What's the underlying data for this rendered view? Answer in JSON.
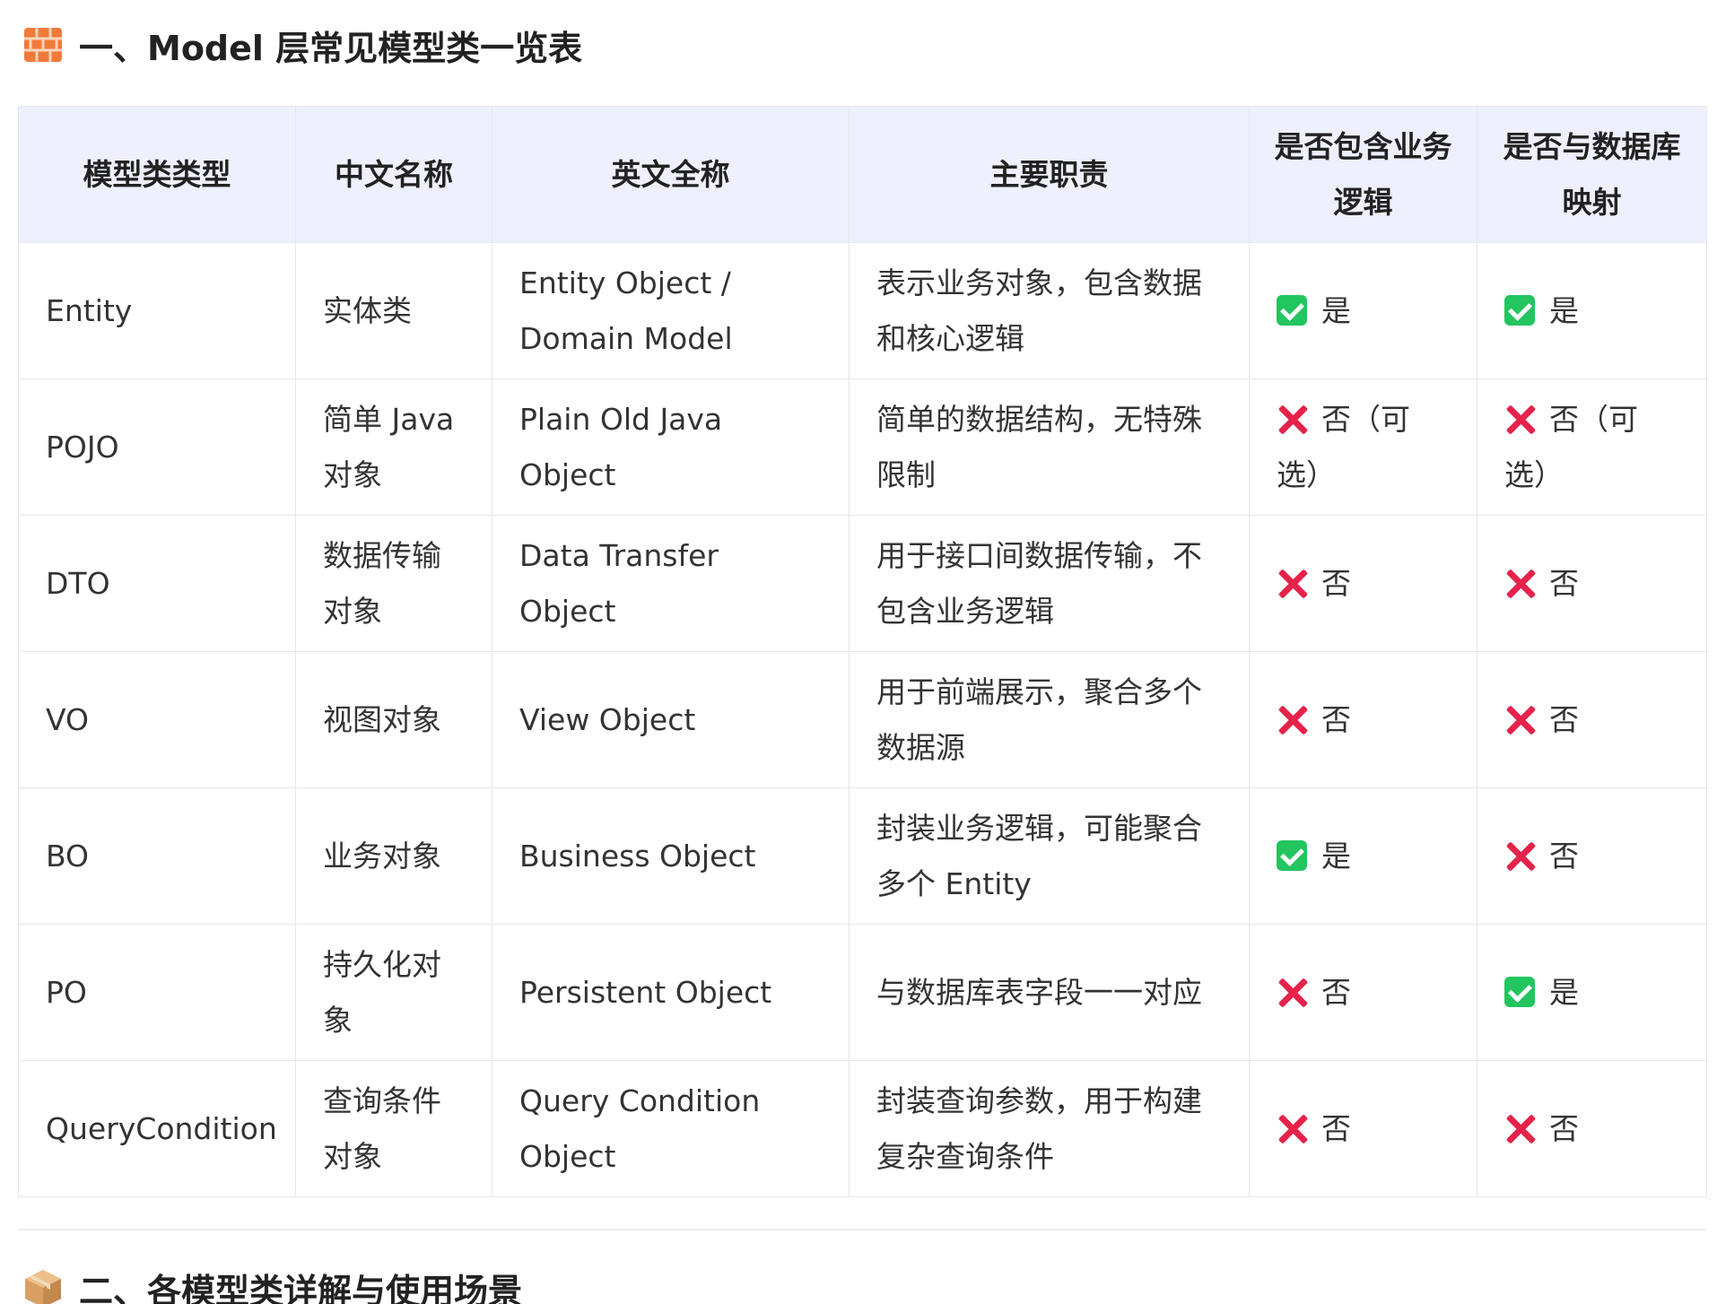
{
  "heading1": {
    "icon": "brick-icon",
    "text": "一、Model 层常见模型类一览表"
  },
  "heading2": {
    "icon": "package-icon",
    "text": "二、各模型类详解与使用场景"
  },
  "table": {
    "headers": [
      "模型类类型",
      "中文名称",
      "英文全称",
      "主要职责",
      "是否包含业务逻辑",
      "是否与数据库映射"
    ],
    "rows": [
      {
        "type": "Entity",
        "cn": "实体类",
        "en": "Entity Object / Domain Model",
        "duty": "表示业务对象，包含数据和核心逻辑",
        "logic_icon": "check",
        "logic": "是",
        "db_icon": "check",
        "db": "是"
      },
      {
        "type": "POJO",
        "cn": "简单 Java 对象",
        "en": "Plain Old Java Object",
        "duty": "简单的数据结构，无特殊限制",
        "logic_icon": "cross",
        "logic": "否（可选）",
        "db_icon": "cross",
        "db": "否（可选）"
      },
      {
        "type": "DTO",
        "cn": "数据传输对象",
        "en": "Data Transfer Object",
        "duty": "用于接口间数据传输，不包含业务逻辑",
        "logic_icon": "cross",
        "logic": "否",
        "db_icon": "cross",
        "db": "否"
      },
      {
        "type": "VO",
        "cn": "视图对象",
        "en": "View Object",
        "duty": "用于前端展示，聚合多个数据源",
        "logic_icon": "cross",
        "logic": "否",
        "db_icon": "cross",
        "db": "否"
      },
      {
        "type": "BO",
        "cn": "业务对象",
        "en": "Business Object",
        "duty": "封装业务逻辑，可能聚合多个 Entity",
        "logic_icon": "check",
        "logic": "是",
        "db_icon": "cross",
        "db": "否"
      },
      {
        "type": "PO",
        "cn": "持久化对象",
        "en": "Persistent Object",
        "duty": "与数据库表字段一一对应",
        "logic_icon": "cross",
        "logic": "否",
        "db_icon": "check",
        "db": "是"
      },
      {
        "type": "QueryCondition",
        "cn": "查询条件对象",
        "en": "Query Condition Object",
        "duty": "封装查询参数，用于构建复杂查询条件",
        "logic_icon": "cross",
        "logic": "否",
        "db_icon": "cross",
        "db": "否"
      }
    ]
  },
  "colors": {
    "header_bg": "#eef0fd",
    "check": "#22c55e",
    "cross": "#e5234a",
    "border": "#e6e6ee"
  }
}
